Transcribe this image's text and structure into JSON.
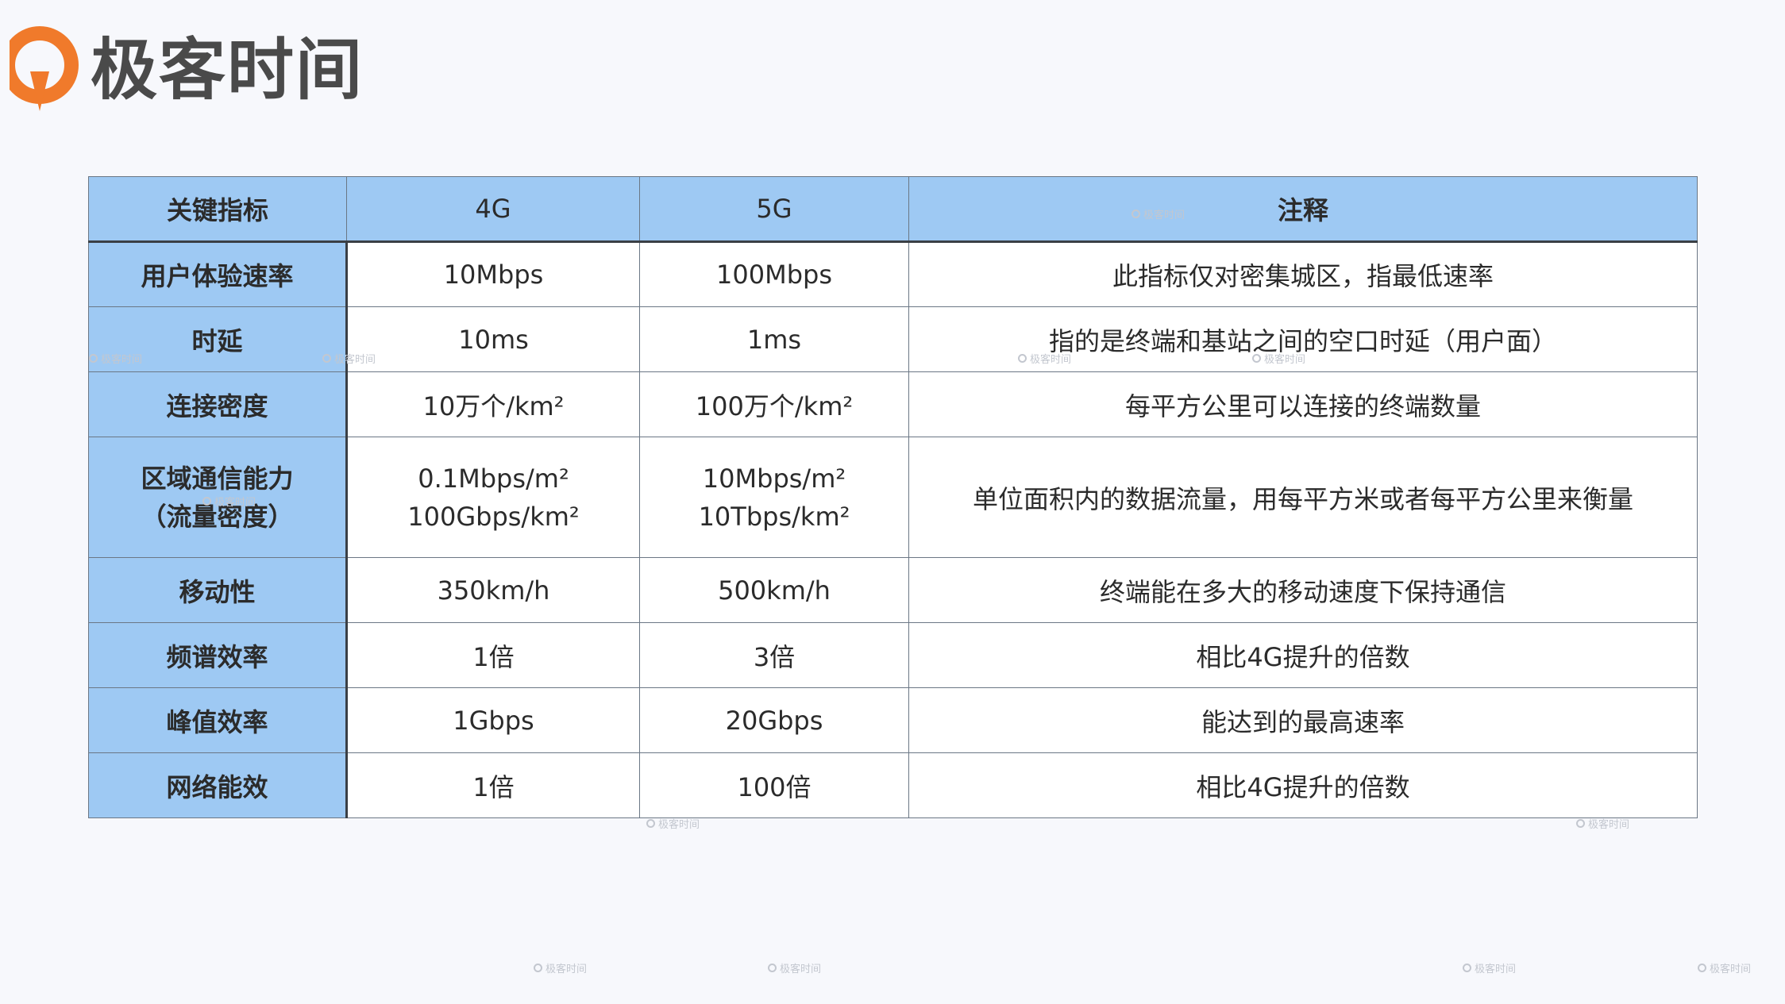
{
  "brand": {
    "name": "极客时间",
    "accent": "#f07a2b",
    "icon": "geektime-logo-icon"
  },
  "table": {
    "headers": [
      "关键指标",
      "4G",
      "5G",
      "注释"
    ],
    "rows": [
      {
        "metric": "用户体验速率",
        "g4": "10Mbps",
        "g5": "100Mbps",
        "note": "此指标仅对密集城区，指最低速率"
      },
      {
        "metric": "时延",
        "g4": "10ms",
        "g5": "1ms",
        "note": "指的是终端和基站之间的空口时延（用户面）"
      },
      {
        "metric": "连接密度",
        "g4": "10万个/km²",
        "g5": "100万个/km²",
        "note": "每平方公里可以连接的终端数量"
      },
      {
        "metric_lines": [
          "区域通信能力",
          "（流量密度）"
        ],
        "g4_lines": [
          "0.1Mbps/m²",
          "100Gbps/km²"
        ],
        "g5_lines": [
          "10Mbps/m²",
          "10Tbps/km²"
        ],
        "note": "单位面积内的数据流量，用每平方米或者每平方公里来衡量"
      },
      {
        "metric": "移动性",
        "g4": "350km/h",
        "g5": "500km/h",
        "note": "终端能在多大的移动速度下保持通信"
      },
      {
        "metric": "频谱效率",
        "g4": "1倍",
        "g5": "3倍",
        "note": "相比4G提升的倍数"
      },
      {
        "metric": "峰值效率",
        "g4": "1Gbps",
        "g5": "20Gbps",
        "note": "能达到的最高速率"
      },
      {
        "metric": "网络能效",
        "g4": "1倍",
        "g5": "100倍",
        "note": "相比4G提升的倍数"
      }
    ]
  },
  "watermark": {
    "text": "极客时间"
  },
  "colors": {
    "header_bg": "#9ec9f3",
    "cell_bg": "#ffffff",
    "page_bg": "#f7f8fc"
  }
}
